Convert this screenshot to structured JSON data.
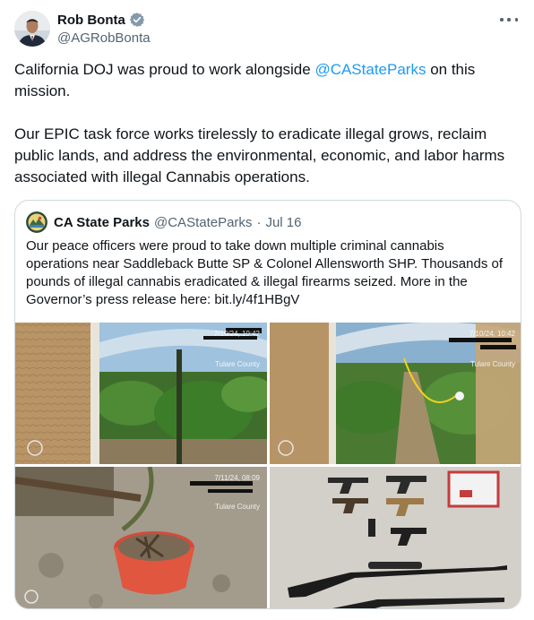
{
  "author": {
    "display_name": "Rob Bonta",
    "handle": "@AGRobBonta",
    "verified": true,
    "avatar_icon": "person-portrait"
  },
  "menu_icon": "more-horizontal-icon",
  "tweet": {
    "line1_prefix": "California DOJ was proud to work alongside ",
    "line1_mention": "@CAStateParks",
    "line1_suffix": " on this mission.",
    "paragraph2": "Our EPIC task force works tirelessly to eradicate illegal grows, reclaim public lands, and address the environmental, economic, and labor harms associated with illegal Cannabis operations."
  },
  "quoted": {
    "display_name": "CA State Parks",
    "handle": "@CAStateParks",
    "separator": "·",
    "date": "Jul 16",
    "text": "Our peace officers were proud to take down multiple criminal cannabis operations near Saddleback Butte SP & Colonel Allensworth SHP. Thousands of pounds of illegal cannabis eradicated & illegal firearms seized. More in the Governor’s press release here: bit.ly/4f1HBgV",
    "media": [
      {
        "description_icon": "greenhouse-cannabis-photo",
        "stamp": "7/10/24, 10:42",
        "stamp2": "Tulare County"
      },
      {
        "description_icon": "greenhouse-cannabis-photo",
        "stamp": "7/10/24, 10:42",
        "stamp2": "Tulare County"
      },
      {
        "description_icon": "bucket-soil-photo",
        "stamp": "7/11/24, 08:09",
        "stamp2": "Tulare County"
      },
      {
        "description_icon": "seized-firearms-photo",
        "stamp": "",
        "stamp2": ""
      }
    ]
  },
  "colors": {
    "text": "#0f1419",
    "secondary": "#536471",
    "link": "#1d9bf0",
    "border": "#cfd9de",
    "verified": "#829aab"
  }
}
